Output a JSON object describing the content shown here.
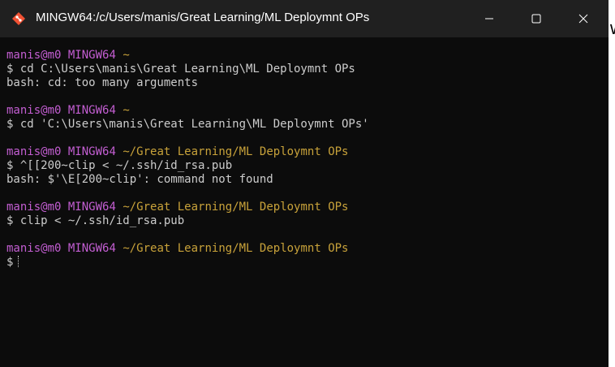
{
  "window": {
    "title": "MINGW64:/c/Users/manis/Great Learning/ML Deploymnt OPs"
  },
  "terminal": {
    "blocks": [
      {
        "user": "manis@m0",
        "host": "MINGW64",
        "path": "~",
        "cmd": "$ cd C:\\Users\\manis\\Great Learning\\ML Deploymnt OPs",
        "out": "bash: cd: too many arguments"
      },
      {
        "user": "manis@m0",
        "host": "MINGW64",
        "path": "~",
        "cmd": "$ cd 'C:\\Users\\manis\\Great Learning\\ML Deploymnt OPs'",
        "out": ""
      },
      {
        "user": "manis@m0",
        "host": "MINGW64",
        "path": "~/Great Learning/ML Deploymnt OPs",
        "cmd": "$ ^[[200~clip < ~/.ssh/id_rsa.pub",
        "out": "bash: $'\\E[200~clip': command not found"
      },
      {
        "user": "manis@m0",
        "host": "MINGW64",
        "path": "~/Great Learning/ML Deploymnt OPs",
        "cmd": "$ clip < ~/.ssh/id_rsa.pub",
        "out": ""
      },
      {
        "user": "manis@m0",
        "host": "MINGW64",
        "path": "~/Great Learning/ML Deploymnt OPs",
        "cmd": "$",
        "out": ""
      }
    ]
  },
  "colors": {
    "user_host": "#c35ed2",
    "path": "#c8a23a",
    "text": "#cccccc",
    "background": "#0c0c0c",
    "titlebar": "#202020"
  },
  "icons": [
    "git-bash-icon",
    "minimize-icon",
    "maximize-icon",
    "close-icon"
  ]
}
